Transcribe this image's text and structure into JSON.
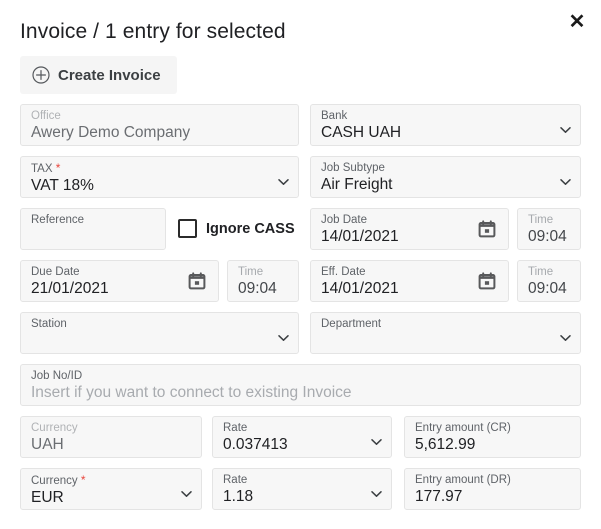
{
  "header": {
    "title": "Invoice / 1 entry for selected",
    "close_label": "✕"
  },
  "toolbar": {
    "create_invoice_label": "Create Invoice",
    "create_invoice_icon": "circle-plus-icon"
  },
  "fields": {
    "office": {
      "label": "Office",
      "value": "Awery Demo Company"
    },
    "bank": {
      "label": "Bank",
      "value": "CASH UAH"
    },
    "tax": {
      "label": "TAX",
      "value": "VAT 18%",
      "required": "*"
    },
    "job_subtype": {
      "label": "Job Subtype",
      "value": "Air Freight"
    },
    "reference": {
      "label": "Reference",
      "value": ""
    },
    "ignore_cass": {
      "label": "Ignore CASS",
      "checked": false
    },
    "job_date": {
      "label": "Job Date",
      "value": "14/01/2021"
    },
    "job_time": {
      "label": "Time",
      "value": "09:04"
    },
    "due_date": {
      "label": "Due Date",
      "value": "21/01/2021"
    },
    "due_time": {
      "label": "Time",
      "value": "09:04"
    },
    "eff_date": {
      "label": "Eff. Date",
      "value": "14/01/2021"
    },
    "eff_time": {
      "label": "Time",
      "value": "09:04"
    },
    "station": {
      "label": "Station",
      "value": ""
    },
    "department": {
      "label": "Department",
      "value": ""
    },
    "job_no_id": {
      "label": "Job No/ID",
      "placeholder": "Insert if you want to connect to existing Invoice"
    },
    "currency_cr": {
      "label": "Currency",
      "value": "UAH"
    },
    "rate_cr": {
      "label": "Rate",
      "value": "0.037413"
    },
    "amount_cr": {
      "label": "Entry amount (CR)",
      "value": "5,612.99"
    },
    "currency_dr": {
      "label": "Currency",
      "value": "EUR",
      "required": "*"
    },
    "rate_dr": {
      "label": "Rate",
      "value": "1.18"
    },
    "amount_dr": {
      "label": "Entry amount (DR)",
      "value": "177.97"
    }
  },
  "colors": {
    "required_asterisk": "#e8453c",
    "field_background": "#f7f7f7",
    "text_primary": "#202124",
    "text_label": "#5f6368"
  }
}
